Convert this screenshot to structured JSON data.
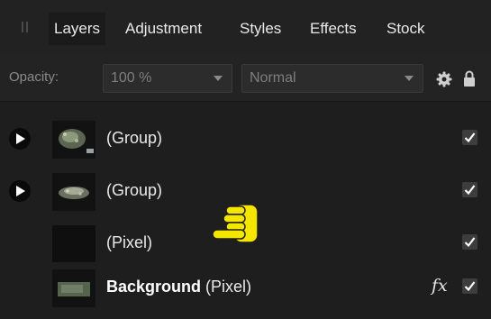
{
  "tabs": [
    {
      "label": "Layers",
      "active": true
    },
    {
      "label": "Adjustment",
      "active": false
    },
    {
      "label": "Styles",
      "active": false
    },
    {
      "label": "Effects",
      "active": false
    },
    {
      "label": "Stock",
      "active": false
    }
  ],
  "options": {
    "opacity_label": "Opacity:",
    "opacity_value": "100 %",
    "blend_mode": "Normal",
    "settings_icon": "gear-icon",
    "lock_icon": "lock-icon"
  },
  "layers": [
    {
      "name": "(Group)",
      "type": "",
      "expandable": true,
      "visible": true,
      "fx": false
    },
    {
      "name": "(Group)",
      "type": "",
      "expandable": true,
      "visible": true,
      "fx": false
    },
    {
      "name": "(Pixel)",
      "type": "",
      "expandable": false,
      "visible": true,
      "fx": false
    },
    {
      "name": "Background",
      "type": " (Pixel)",
      "expandable": false,
      "visible": true,
      "fx": true,
      "fx_label": "fx"
    }
  ],
  "colors": {
    "panel_bg": "#1e1e1e",
    "cursor": "#f5e600"
  }
}
